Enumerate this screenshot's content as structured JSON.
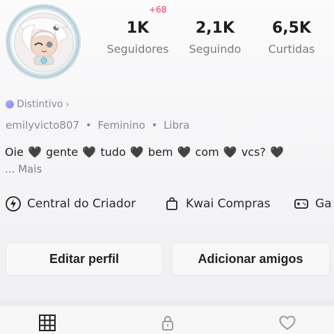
{
  "profile": {
    "notification_count": "+68",
    "stats": [
      {
        "value": "1K",
        "label": "Seguidores"
      },
      {
        "value": "2,1K",
        "label": "Seguindo"
      },
      {
        "value": "6,5K",
        "label": "Curtidas"
      }
    ],
    "distintivo_label": "Distintivo",
    "meta": {
      "username": "emilyvicto807",
      "gender": "Feminino",
      "sign": "Libra"
    },
    "bio": {
      "parts": [
        "Oie",
        "gente",
        "tudo",
        "bem",
        "com",
        "vcs?"
      ],
      "heart": "🖤",
      "more": "... Mais"
    }
  },
  "quick_links": [
    {
      "label": "Central do Criador",
      "icon": "lightning-circle-icon"
    },
    {
      "label": "Kwai Compras",
      "icon": "shopping-bag-icon"
    },
    {
      "label": "Ga",
      "icon": "game-controller-icon"
    }
  ],
  "actions": {
    "edit_profile": "Editar perfil",
    "add_friends": "Adicionar amigos"
  },
  "tabs": [
    {
      "icon": "grid-icon"
    },
    {
      "icon": "lock-icon"
    },
    {
      "icon": "heart-icon"
    }
  ],
  "colors": {
    "accent_red": "#ff2d55",
    "badge_purple": "#7e7cf5",
    "text_dark": "#1f1f22",
    "text_muted": "#888891"
  }
}
